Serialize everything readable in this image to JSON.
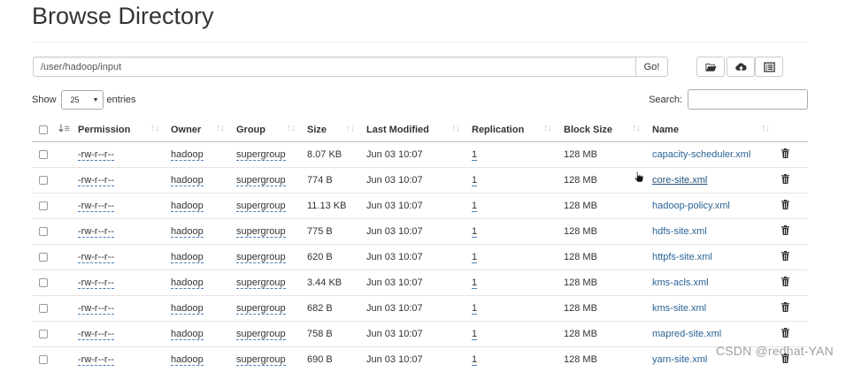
{
  "page": {
    "title": "Browse Directory"
  },
  "pathbar": {
    "value": "/user/hadoop/input",
    "go_label": "Go!"
  },
  "toolbar": {
    "buttons": [
      {
        "icon": "folder-open-icon"
      },
      {
        "icon": "cloud-upload-icon"
      },
      {
        "icon": "list-alt-icon"
      }
    ]
  },
  "entries": {
    "show_label": "Show",
    "page_size": "25",
    "entries_label": "entries"
  },
  "search": {
    "label": "Search:",
    "value": ""
  },
  "table": {
    "headers": {
      "permission": "Permission",
      "owner": "Owner",
      "group": "Group",
      "size": "Size",
      "last_modified": "Last Modified",
      "replication": "Replication",
      "block_size": "Block Size",
      "name": "Name"
    },
    "rows": [
      {
        "permission": "-rw-r--r--",
        "owner": "hadoop",
        "group": "supergroup",
        "size": "8.07 KB",
        "last_modified": "Jun 03 10:07",
        "replication": "1",
        "block_size": "128 MB",
        "name": "capacity-scheduler.xml"
      },
      {
        "permission": "-rw-r--r--",
        "owner": "hadoop",
        "group": "supergroup",
        "size": "774 B",
        "last_modified": "Jun 03 10:07",
        "replication": "1",
        "block_size": "128 MB",
        "name": "core-site.xml"
      },
      {
        "permission": "-rw-r--r--",
        "owner": "hadoop",
        "group": "supergroup",
        "size": "11.13 KB",
        "last_modified": "Jun 03 10:07",
        "replication": "1",
        "block_size": "128 MB",
        "name": "hadoop-policy.xml"
      },
      {
        "permission": "-rw-r--r--",
        "owner": "hadoop",
        "group": "supergroup",
        "size": "775 B",
        "last_modified": "Jun 03 10:07",
        "replication": "1",
        "block_size": "128 MB",
        "name": "hdfs-site.xml"
      },
      {
        "permission": "-rw-r--r--",
        "owner": "hadoop",
        "group": "supergroup",
        "size": "620 B",
        "last_modified": "Jun 03 10:07",
        "replication": "1",
        "block_size": "128 MB",
        "name": "httpfs-site.xml"
      },
      {
        "permission": "-rw-r--r--",
        "owner": "hadoop",
        "group": "supergroup",
        "size": "3.44 KB",
        "last_modified": "Jun 03 10:07",
        "replication": "1",
        "block_size": "128 MB",
        "name": "kms-acls.xml"
      },
      {
        "permission": "-rw-r--r--",
        "owner": "hadoop",
        "group": "supergroup",
        "size": "682 B",
        "last_modified": "Jun 03 10:07",
        "replication": "1",
        "block_size": "128 MB",
        "name": "kms-site.xml"
      },
      {
        "permission": "-rw-r--r--",
        "owner": "hadoop",
        "group": "supergroup",
        "size": "758 B",
        "last_modified": "Jun 03 10:07",
        "replication": "1",
        "block_size": "128 MB",
        "name": "mapred-site.xml"
      },
      {
        "permission": "-rw-r--r--",
        "owner": "hadoop",
        "group": "supergroup",
        "size": "690 B",
        "last_modified": "Jun 03 10:07",
        "replication": "1",
        "block_size": "128 MB",
        "name": "yarn-site.xml"
      }
    ]
  },
  "watermark": "CSDN @redhat-YAN"
}
